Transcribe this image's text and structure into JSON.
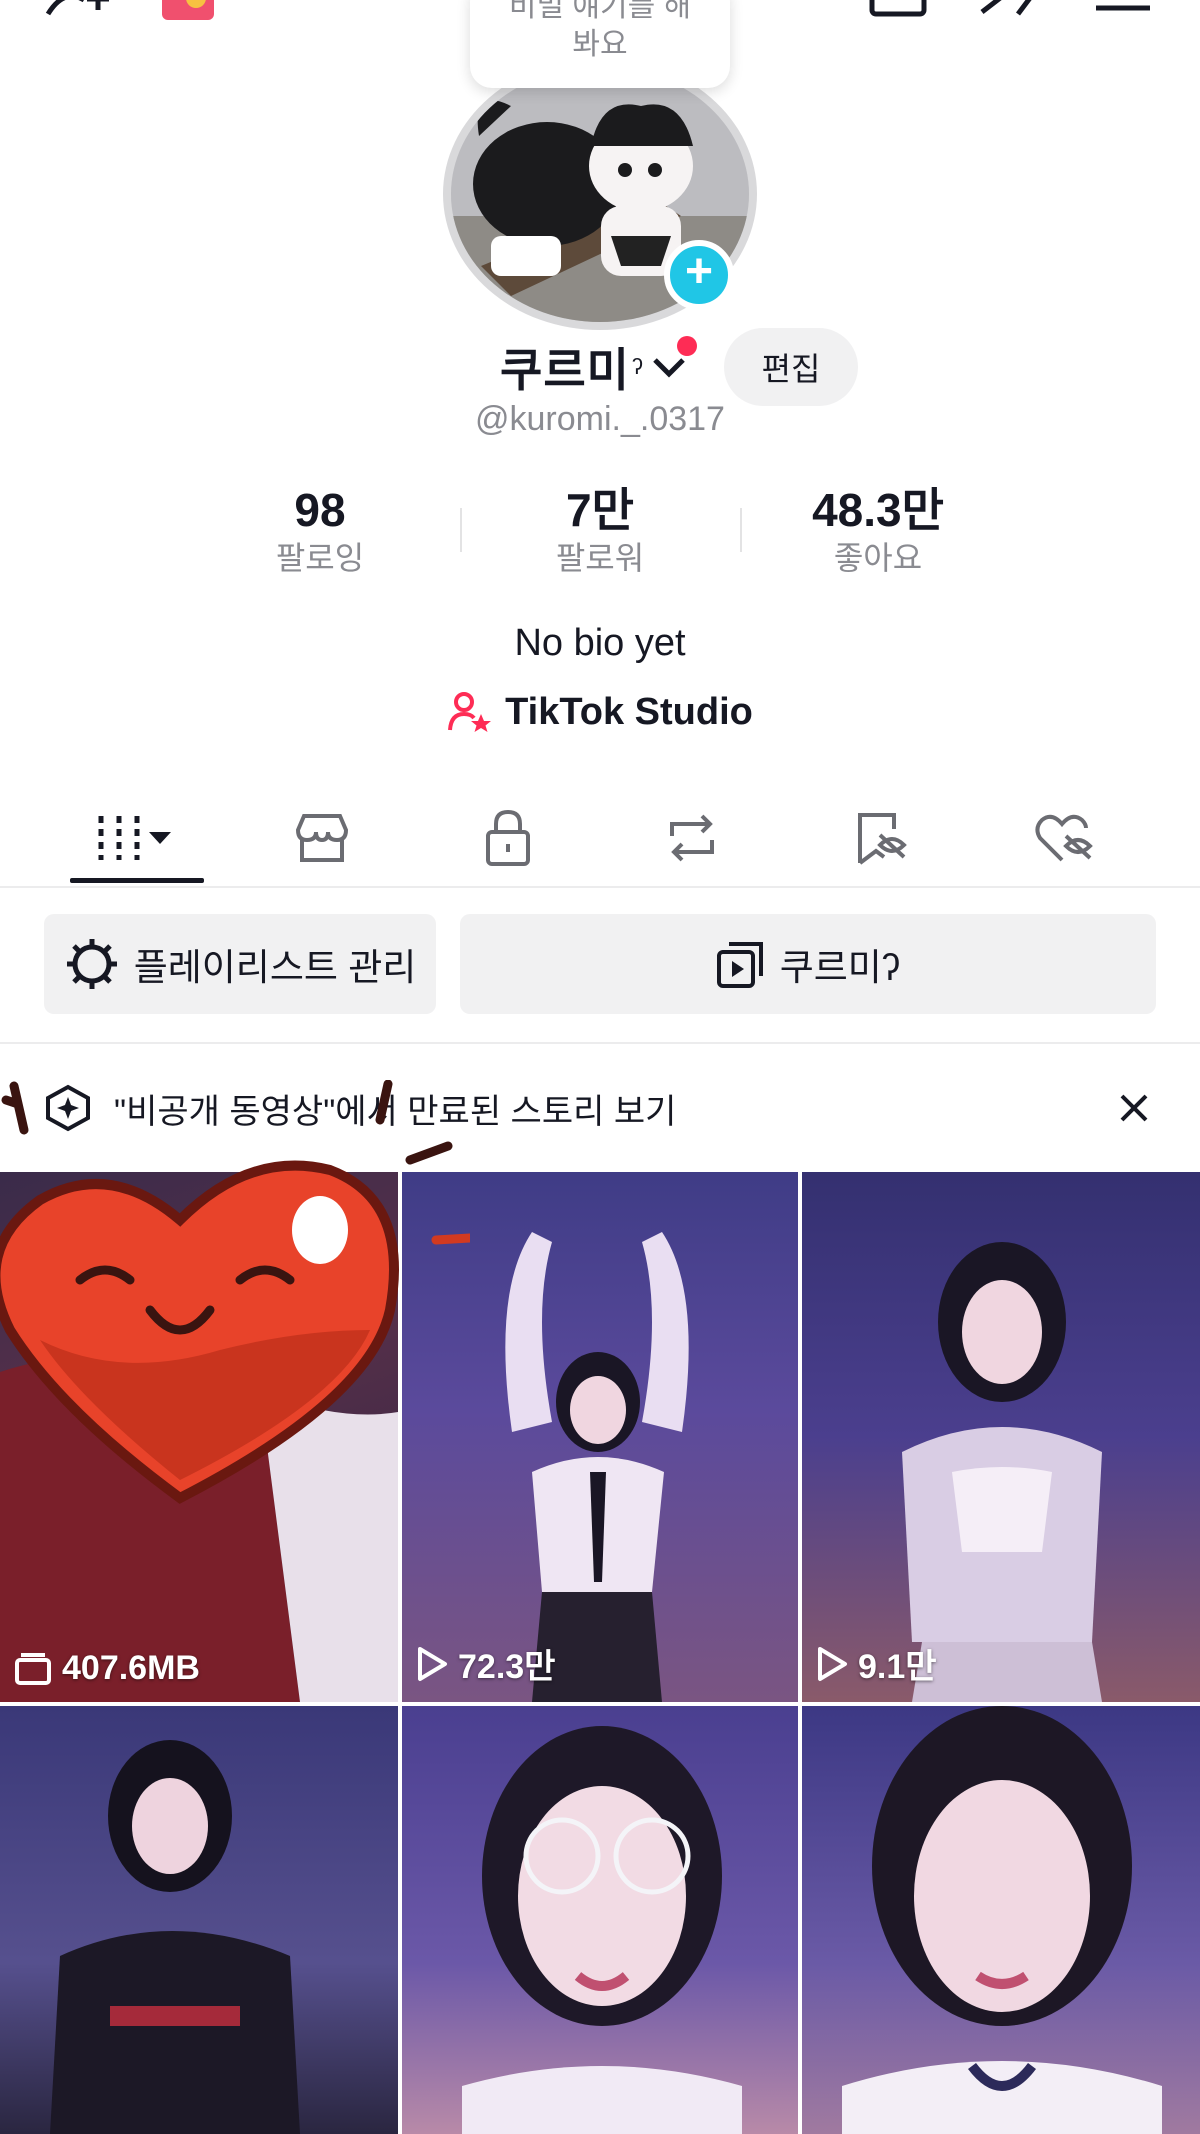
{
  "tooltip": {
    "line1": "비밀 얘기를 해",
    "line2": "봐요"
  },
  "profile": {
    "name": "쿠르미",
    "name_sup": "ʔ",
    "edit_label": "편집",
    "handle": "@kuromi._.0317",
    "bio": "No bio yet",
    "studio_label": "TikTok Studio"
  },
  "stats": [
    {
      "value": "98",
      "label": "팔로잉"
    },
    {
      "value": "7만",
      "label": "팔로워"
    },
    {
      "value": "48.3만",
      "label": "좋아요"
    }
  ],
  "tabs": [
    {
      "icon": "videos-grid-icon",
      "selected": true
    },
    {
      "icon": "shop-icon"
    },
    {
      "icon": "lock-icon"
    },
    {
      "icon": "repost-icon"
    },
    {
      "icon": "saved-hidden-icon"
    },
    {
      "icon": "liked-hidden-icon"
    }
  ],
  "playlist": {
    "manage_label": "플레이리스트 관리",
    "playlist_label": "쿠르미ʔ"
  },
  "notice": {
    "text": "\"비공개 동영상\"에서 만료된 스토리 보기"
  },
  "videos": [
    {
      "label": "407.6MB",
      "kind": "draft"
    },
    {
      "label": "72.3만",
      "kind": "views"
    },
    {
      "label": "9.1만",
      "kind": "views"
    },
    {
      "label": "",
      "kind": "none"
    },
    {
      "label": "",
      "kind": "none"
    },
    {
      "label": "",
      "kind": "none"
    }
  ],
  "colors": {
    "accent": "#fe2c55",
    "cyan": "#20c6e6",
    "muted": "#8a8b91"
  }
}
